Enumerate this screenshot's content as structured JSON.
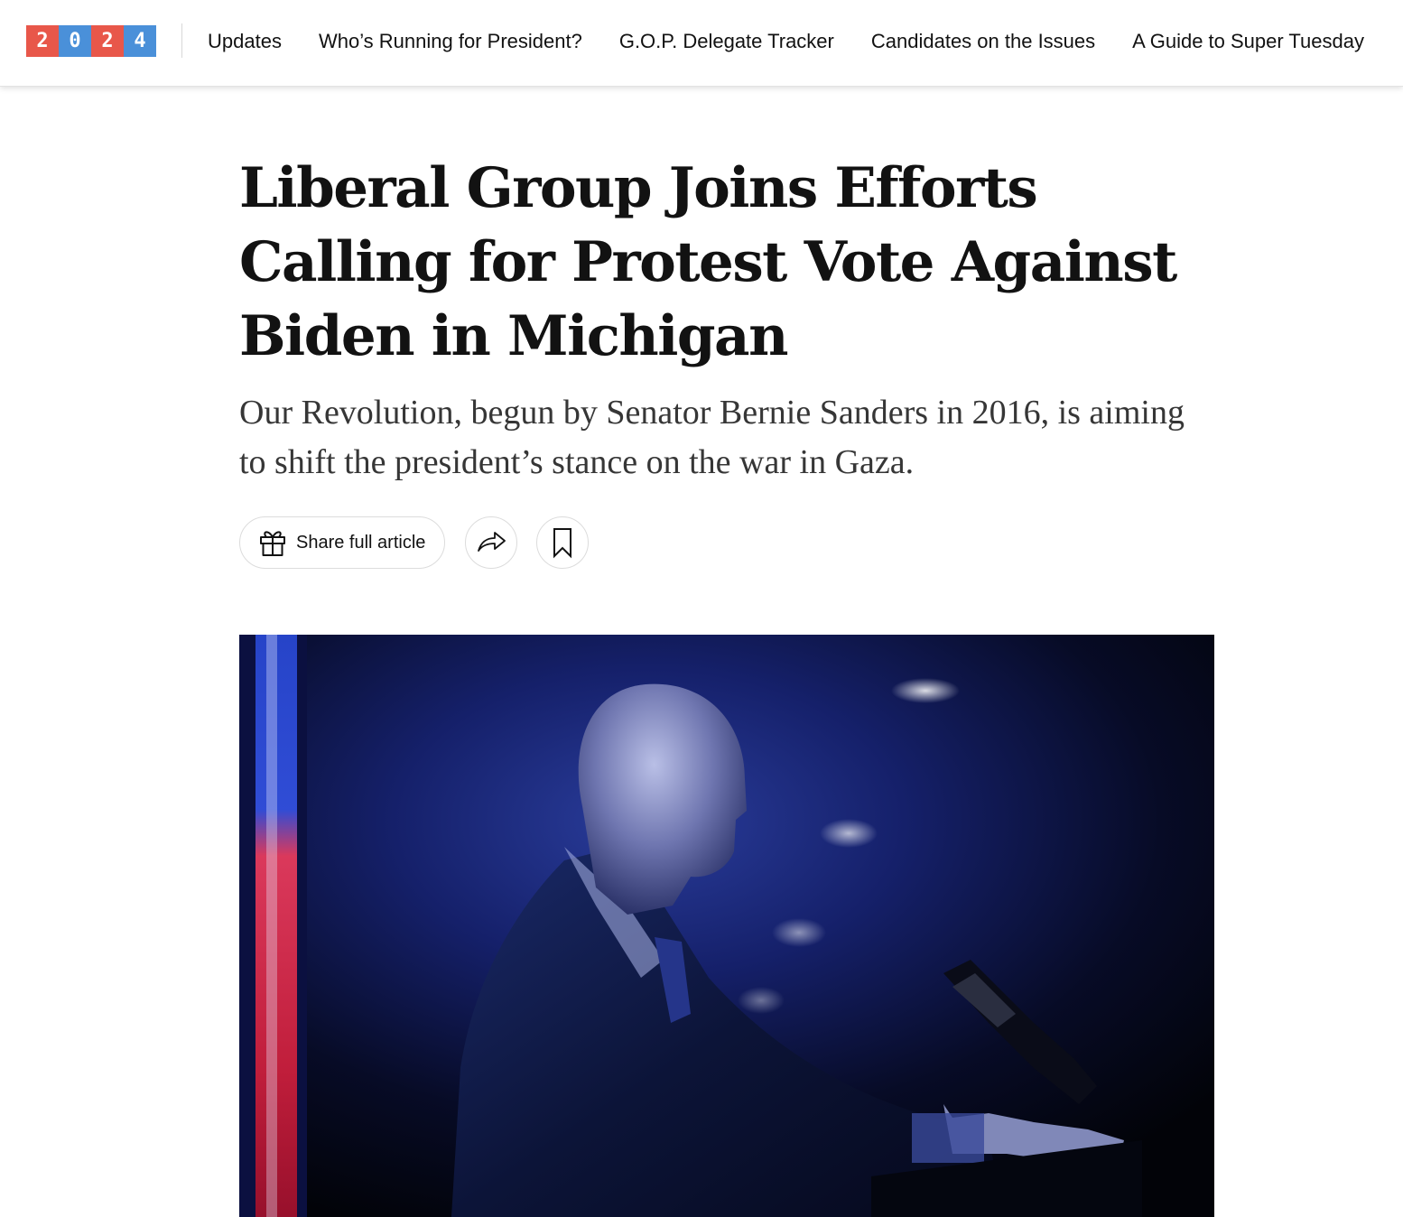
{
  "logo": {
    "digits": [
      "2",
      "0",
      "2",
      "4"
    ],
    "colors": [
      "#e8574a",
      "#4a90d9",
      "#e8574a",
      "#4a90d9"
    ]
  },
  "nav": {
    "items": [
      {
        "label": "Updates"
      },
      {
        "label": "Who’s Running for President?"
      },
      {
        "label": "G.O.P. Delegate Tracker"
      },
      {
        "label": "Candidates on the Issues"
      },
      {
        "label": "A Guide to Super Tuesday"
      }
    ]
  },
  "article": {
    "headline": "Liberal Group Joins Efforts Calling for Protest Vote Against Biden in Michigan",
    "summary": "Our Revolution, begun by Senator Bernie Sanders in 2016, is aiming to shift the president’s stance on the war in Gaza."
  },
  "actions": {
    "share_full_article": "Share full article",
    "gift_icon": "gift-icon",
    "share_icon": "share-arrow-icon",
    "save_icon": "bookmark-icon"
  },
  "photo": {
    "subject": "lead-photo"
  }
}
